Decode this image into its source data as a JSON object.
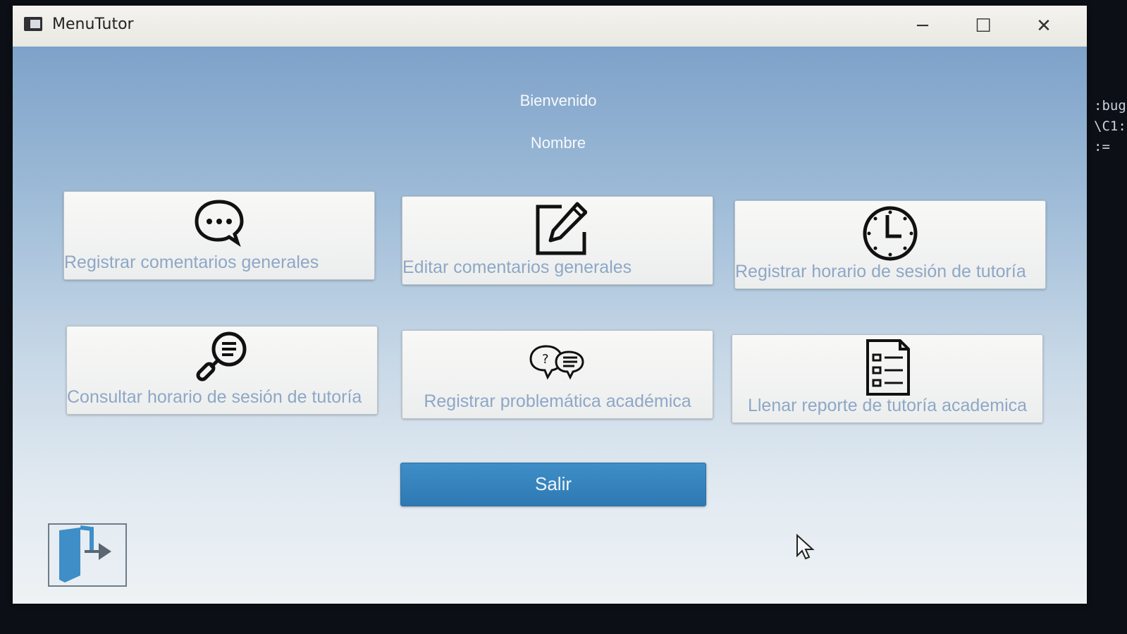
{
  "window": {
    "title": "MenuTutor",
    "minimize_glyph": "─",
    "maximize_glyph": "☐",
    "close_glyph": "✕"
  },
  "header": {
    "welcome": "Bienvenido",
    "name": "Nombre"
  },
  "menu": [
    {
      "label": "Registrar comentarios generales",
      "icon": "speech-bubble-icon"
    },
    {
      "label": "Editar comentarios generales",
      "icon": "edit-pencil-icon"
    },
    {
      "label": "Registrar horario de sesión de tutoría",
      "icon": "clock-icon"
    },
    {
      "label": "Consultar horario de sesión de tutoría",
      "icon": "search-document-icon"
    },
    {
      "label": "Registrar problemática académica",
      "icon": "question-chat-icon"
    },
    {
      "label": "Llenar reporte de tutoría academica",
      "icon": "checklist-report-icon"
    }
  ],
  "exit_button": {
    "label": "Salir"
  },
  "logout_icon": "logout-door-icon",
  "background_terminal_lines": [
    ":bug",
    "\\C1:",
    ":="
  ],
  "colors": {
    "accent_button": "#2e79b3",
    "label_text": "#8ea7c6",
    "header_text": "#f7f9fc"
  }
}
